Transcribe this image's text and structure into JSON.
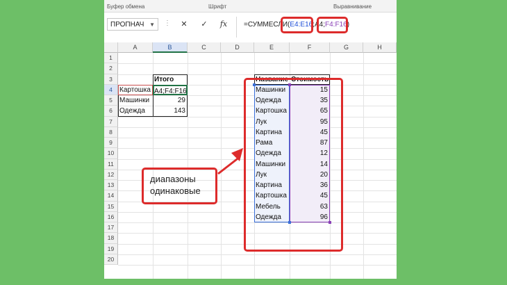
{
  "ribbon_groups": [
    "Буфер обмена",
    "Шрифт",
    "Выравнивание"
  ],
  "formula_bar": {
    "name_box": "ПРОПНАЧ",
    "cancel": "✕",
    "enter": "✓",
    "fx": "fx",
    "formula_prefix": "=СУММЕСЛИ(",
    "formula_range1": "E4:E16",
    "formula_sep": ";A4;",
    "formula_range2": "F4:F16",
    "formula_suffix": ")"
  },
  "columns": [
    "A",
    "B",
    "C",
    "D",
    "E",
    "F",
    "G",
    "H"
  ],
  "rows": [
    "1",
    "2",
    "3",
    "4",
    "5",
    "6",
    "7",
    "8",
    "9",
    "10",
    "11",
    "12",
    "13",
    "14",
    "15",
    "16",
    "17",
    "18",
    "19",
    "20"
  ],
  "summary_table": {
    "header": "Итого",
    "rows": [
      {
        "name": "Картошка",
        "value": "A4;F4:F16)"
      },
      {
        "name": "Машинки",
        "value": "29"
      },
      {
        "name": "Одежда",
        "value": "143"
      }
    ]
  },
  "data_table": {
    "headers": [
      "Название",
      "Стоимость"
    ],
    "rows": [
      {
        "name": "Машинки",
        "cost": "15"
      },
      {
        "name": "Одежда",
        "cost": "35"
      },
      {
        "name": "Картошка",
        "cost": "65"
      },
      {
        "name": "Лук",
        "cost": "95"
      },
      {
        "name": "Картина",
        "cost": "45"
      },
      {
        "name": "Рама",
        "cost": "87"
      },
      {
        "name": "Одежда",
        "cost": "12"
      },
      {
        "name": "Машинки",
        "cost": "14"
      },
      {
        "name": "Лук",
        "cost": "20"
      },
      {
        "name": "Картина",
        "cost": "36"
      },
      {
        "name": "Картошка",
        "cost": "45"
      },
      {
        "name": "Мебель",
        "cost": "63"
      },
      {
        "name": "Одежда",
        "cost": "96"
      }
    ]
  },
  "callout": {
    "line1": "диапазоны",
    "line2": "одинаковые"
  },
  "colors": {
    "annotation": "#dd2b2b",
    "range1": "#1f4fd8",
    "range2": "#8a3fb7",
    "background": "#6dbf67"
  }
}
